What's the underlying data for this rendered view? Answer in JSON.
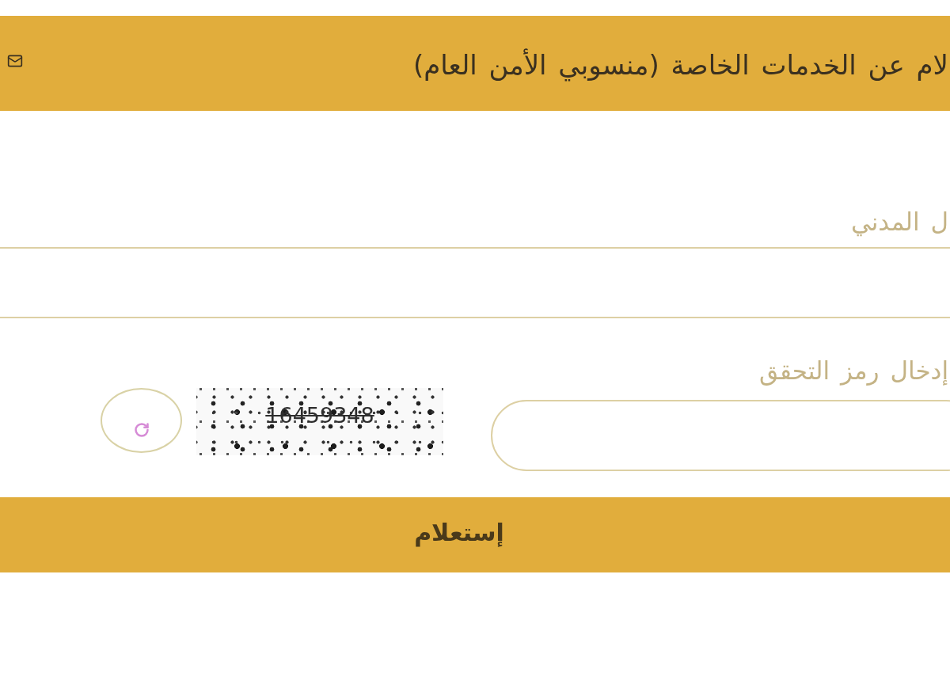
{
  "header": {
    "title": "لام عن الخدمات الخاصة (منسوبي الأمن العام)"
  },
  "form": {
    "fields": [
      {
        "kind": "text",
        "label": "ل المدني"
      },
      {
        "kind": "captcha",
        "label": "إدخال رمز التحقق",
        "captcha_code": "16459348"
      }
    ],
    "submit_button": "إستعلام"
  }
}
